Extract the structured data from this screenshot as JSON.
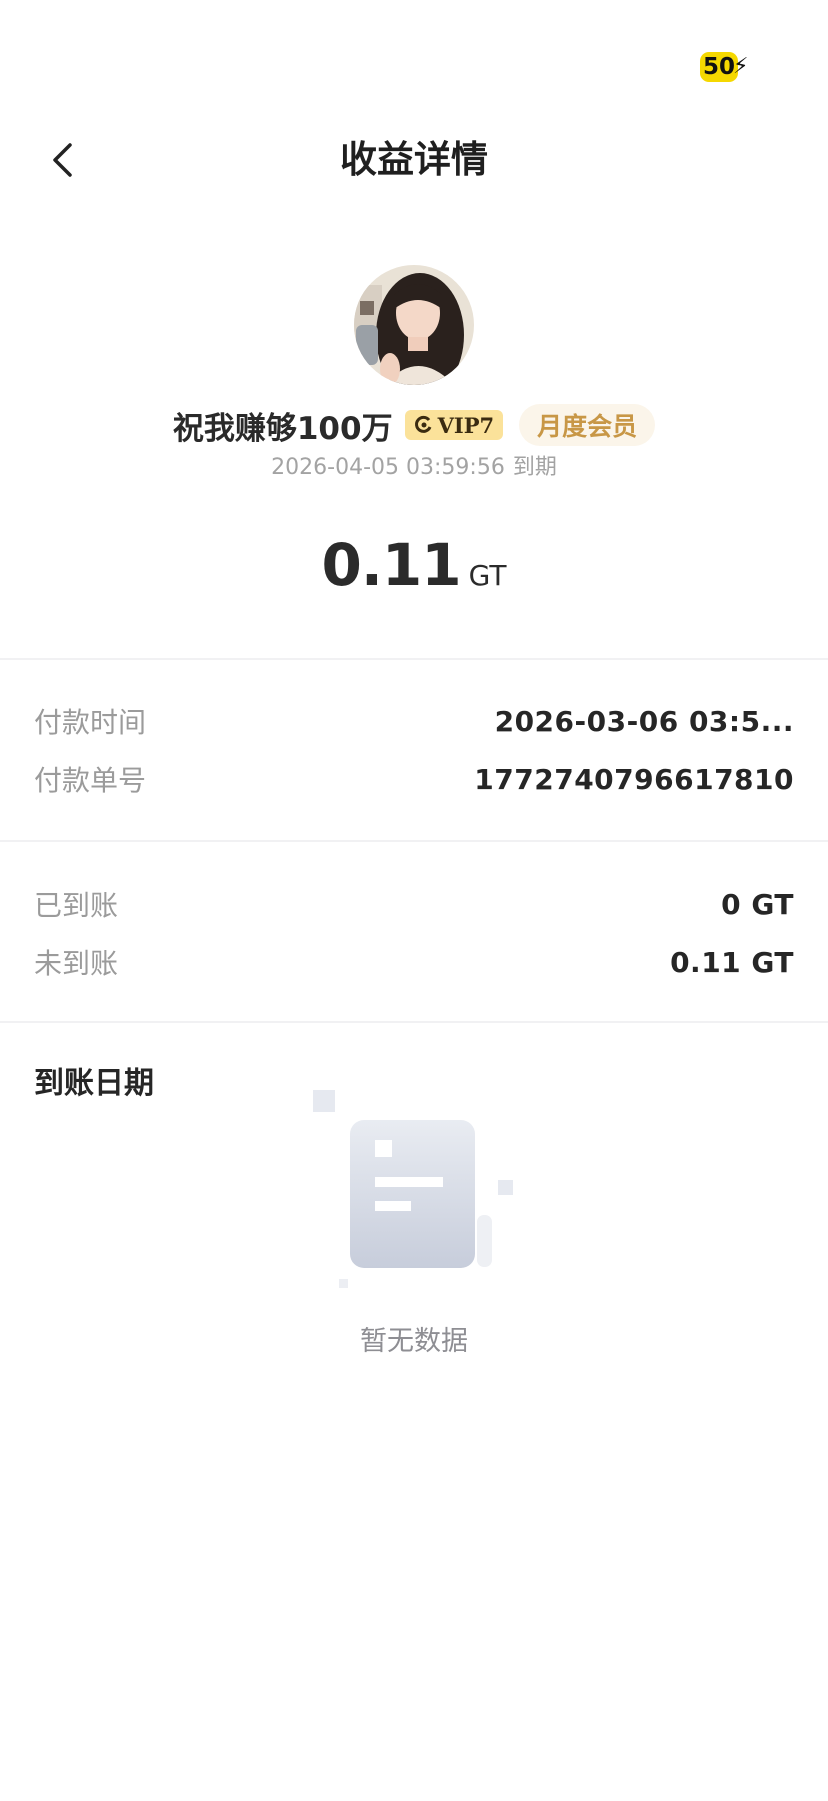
{
  "status_bar": {
    "battery": "50"
  },
  "header": {
    "title": "收益详情"
  },
  "profile": {
    "username": "祝我赚够100万",
    "vip_label": "VIP7",
    "membership": "月度会员",
    "expire_time": "2026-04-05 03:59:56",
    "expire_suffix": "到期"
  },
  "earnings": {
    "amount": "0.11",
    "unit": "GT"
  },
  "payment": {
    "time_label": "付款时间",
    "time_value": "2026-03-06 03:5...",
    "order_label": "付款单号",
    "order_value": "1772740796617810"
  },
  "settlement": {
    "received_label": "已到账",
    "received_value": "0 GT",
    "pending_label": "未到账",
    "pending_value": "0.11 GT"
  },
  "arrival": {
    "title": "到账日期",
    "empty_text": "暂无数据"
  }
}
